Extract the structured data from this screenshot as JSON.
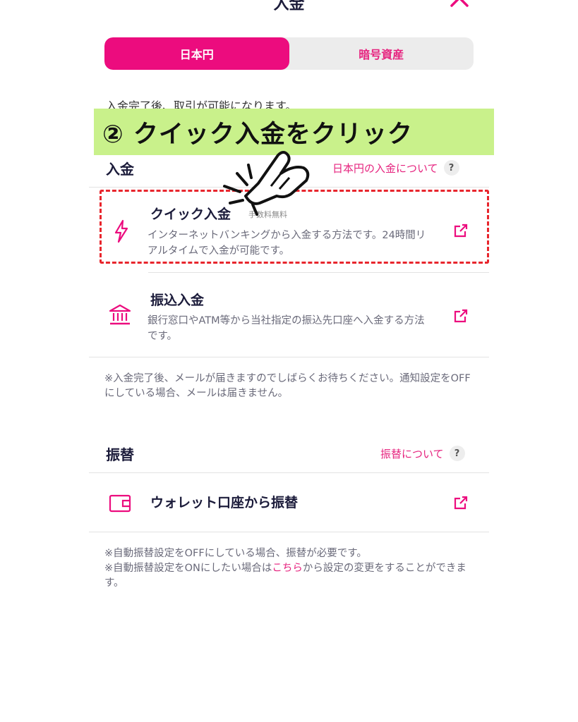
{
  "header": {
    "title": "入金"
  },
  "tabs": [
    {
      "label": "日本円",
      "active": true
    },
    {
      "label": "暗号資産",
      "active": false
    }
  ],
  "notice": "入金完了後、取引が可能になります。",
  "banner": {
    "text": "② クイック入金をクリック",
    "color": "#c9f18b"
  },
  "deposit_section": {
    "title": "入金",
    "help_link": "日本円の入金について",
    "items": [
      {
        "title": "クイック入金",
        "fee": "手数料無料",
        "description": "インターネットバンキングから入金する方法です。24時間リアルタイムで入金が可能です。",
        "icon": "lightning-icon"
      },
      {
        "title": "振込入金",
        "description": "銀行窓口やATM等から当社指定の振込先口座へ入金する方法です。",
        "icon": "bank-icon"
      }
    ],
    "note": "※入金完了後、メールが届きますのでしばらくお待ちください。通知設定をOFFにしている場合、メールは届きません。"
  },
  "transfer_section": {
    "title": "振替",
    "help_link": "振替について",
    "items": [
      {
        "title": "ウォレット口座から振替",
        "icon": "wallet-icon"
      }
    ],
    "note1": "※自動振替設定をOFFにしている場合、振替が必要です。",
    "note2_before": "※自動振替設定をONにしたい場合は",
    "note2_link": "こちら",
    "note2_after": "から設定の変更をすることができます。"
  },
  "colors": {
    "accent": "#ec0c7e",
    "highlight": "#e8262d",
    "text": "#1b1b3a"
  }
}
